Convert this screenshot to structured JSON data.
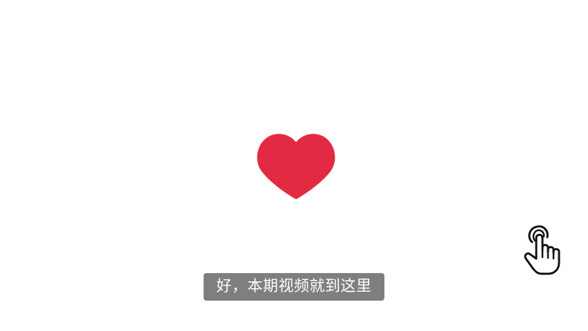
{
  "video": {
    "subtitle": "好，本期视频就到这里"
  },
  "icons": {
    "heart": "heart-icon",
    "cursor": "hand-pointer-icon"
  },
  "colors": {
    "background": "#ffffff",
    "heart": "#e22b42",
    "subtitle_bg": "#7f7f7f",
    "subtitle_text": "#ffffff",
    "cursor_outline": "#111111",
    "cursor_fill": "#ffffff"
  }
}
